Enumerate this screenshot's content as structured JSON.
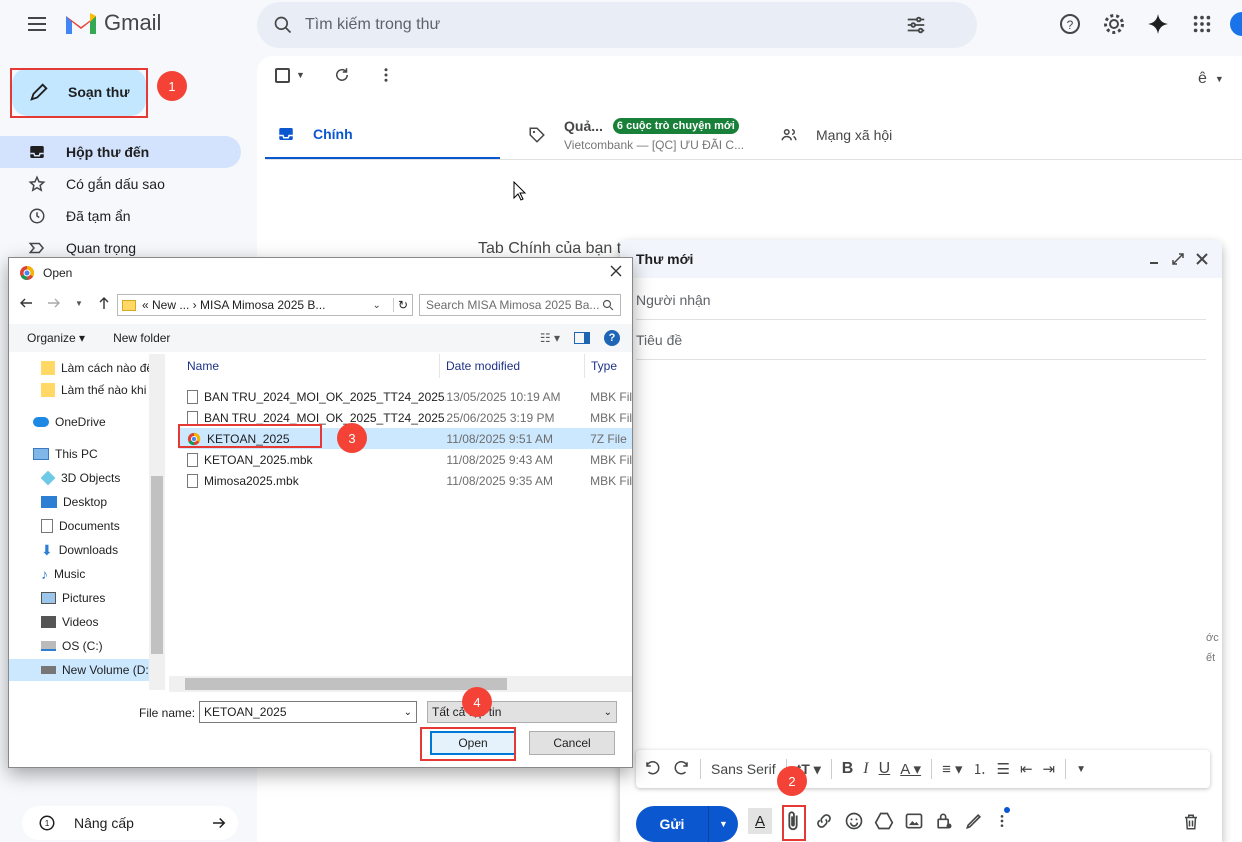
{
  "app": {
    "logo_text": "Gmail"
  },
  "search": {
    "placeholder": "Tìm kiếm trong thư"
  },
  "nav": {
    "compose_label": "Soạn thư",
    "items": [
      {
        "label": "Hộp thư đến",
        "icon": "inbox-icon",
        "active": true
      },
      {
        "label": "Có gắn dấu sao",
        "icon": "star-icon"
      },
      {
        "label": "Đã tạm ẩn",
        "icon": "clock-icon"
      },
      {
        "label": "Quan trọng",
        "icon": "label-important-icon"
      }
    ],
    "upgrade_label": "Nâng cấp"
  },
  "tabs": {
    "primary": "Chính",
    "promo": "Quả...",
    "promo_badge": "6 cuộc trò chuyện mới",
    "promo_snippet": "Vietcombank — [QC] ƯU ĐÃI C...",
    "social": "Mạng xã hội"
  },
  "toolbar": {
    "lang_label": "ê"
  },
  "main": {
    "empty_text": "Tab Chính của bạn t"
  },
  "compose_window": {
    "title": "Thư mới",
    "to_placeholder": "Người nhận",
    "subject_placeholder": "Tiêu đề",
    "font": "Sans Serif",
    "send_label": "Gửi",
    "edge_text_1": "ớc",
    "edge_text_2": "ết"
  },
  "dialog": {
    "title": "Open",
    "address": "« New ... › MISA Mimosa 2025 B...",
    "search_placeholder": "Search MISA Mimosa 2025 Ba...",
    "organize": "Organize",
    "new_folder": "New folder",
    "tree": [
      {
        "label": "Làm cách nào để",
        "icon": "folder-icon"
      },
      {
        "label": "Làm thế nào khi",
        "icon": "folder-icon"
      },
      {
        "label": "OneDrive",
        "icon": "cloud-icon"
      },
      {
        "label": "This PC",
        "icon": "pc-icon"
      },
      {
        "label": "3D Objects",
        "icon": "cube-icon"
      },
      {
        "label": "Desktop",
        "icon": "desktop-icon"
      },
      {
        "label": "Documents",
        "icon": "document-icon"
      },
      {
        "label": "Downloads",
        "icon": "download-icon"
      },
      {
        "label": "Music",
        "icon": "music-icon"
      },
      {
        "label": "Pictures",
        "icon": "picture-icon"
      },
      {
        "label": "Videos",
        "icon": "video-icon"
      },
      {
        "label": "OS (C:)",
        "icon": "drive-icon"
      },
      {
        "label": "New Volume (D:)",
        "icon": "drive-icon"
      }
    ],
    "columns": {
      "name": "Name",
      "date": "Date modified",
      "type": "Type"
    },
    "files": [
      {
        "name": "BAN TRU_2024_MOI_OK_2025_TT24_2025...",
        "date": "13/05/2025 10:19 AM",
        "type": "MBK File"
      },
      {
        "name": "BAN TRU_2024_MOI_OK_2025_TT24_2025...",
        "date": "25/06/2025 3:19 PM",
        "type": "MBK File"
      },
      {
        "name": "KETOAN_2025",
        "date": "11/08/2025 9:51 AM",
        "type": "7Z File"
      },
      {
        "name": "KETOAN_2025.mbk",
        "date": "11/08/2025 9:43 AM",
        "type": "MBK File"
      },
      {
        "name": "Mimosa2025.mbk",
        "date": "11/08/2025 9:35 AM",
        "type": "MBK File"
      }
    ],
    "filename_label": "File name:",
    "filename_value": "KETOAN_2025",
    "filetype_value": "Tất cả tệp tin",
    "open_label": "Open",
    "cancel_label": "Cancel"
  },
  "steps": {
    "s1": "1",
    "s2": "2",
    "s3": "3",
    "s4": "4"
  },
  "colors": {
    "accent": "#0b57d0",
    "compose_bg": "#c2e7ff",
    "annotation": "#e53935"
  }
}
